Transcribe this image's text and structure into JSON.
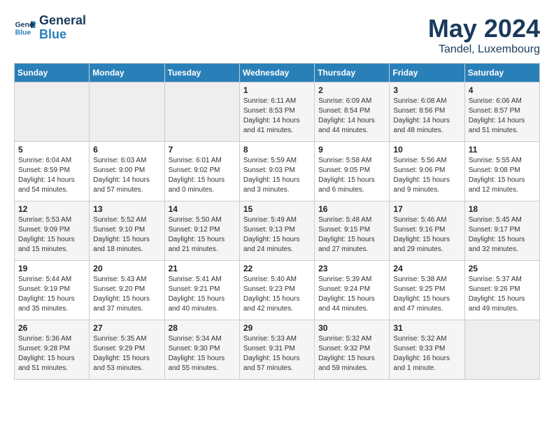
{
  "header": {
    "logo_line1": "General",
    "logo_line2": "Blue",
    "month": "May 2024",
    "location": "Tandel, Luxembourg"
  },
  "days_of_week": [
    "Sunday",
    "Monday",
    "Tuesday",
    "Wednesday",
    "Thursday",
    "Friday",
    "Saturday"
  ],
  "weeks": [
    [
      {
        "day": "",
        "content": ""
      },
      {
        "day": "",
        "content": ""
      },
      {
        "day": "",
        "content": ""
      },
      {
        "day": "1",
        "content": "Sunrise: 6:11 AM\nSunset: 8:53 PM\nDaylight: 14 hours\nand 41 minutes."
      },
      {
        "day": "2",
        "content": "Sunrise: 6:09 AM\nSunset: 8:54 PM\nDaylight: 14 hours\nand 44 minutes."
      },
      {
        "day": "3",
        "content": "Sunrise: 6:08 AM\nSunset: 8:56 PM\nDaylight: 14 hours\nand 48 minutes."
      },
      {
        "day": "4",
        "content": "Sunrise: 6:06 AM\nSunset: 8:57 PM\nDaylight: 14 hours\nand 51 minutes."
      }
    ],
    [
      {
        "day": "5",
        "content": "Sunrise: 6:04 AM\nSunset: 8:59 PM\nDaylight: 14 hours\nand 54 minutes."
      },
      {
        "day": "6",
        "content": "Sunrise: 6:03 AM\nSunset: 9:00 PM\nDaylight: 14 hours\nand 57 minutes."
      },
      {
        "day": "7",
        "content": "Sunrise: 6:01 AM\nSunset: 9:02 PM\nDaylight: 15 hours\nand 0 minutes."
      },
      {
        "day": "8",
        "content": "Sunrise: 5:59 AM\nSunset: 9:03 PM\nDaylight: 15 hours\nand 3 minutes."
      },
      {
        "day": "9",
        "content": "Sunrise: 5:58 AM\nSunset: 9:05 PM\nDaylight: 15 hours\nand 6 minutes."
      },
      {
        "day": "10",
        "content": "Sunrise: 5:56 AM\nSunset: 9:06 PM\nDaylight: 15 hours\nand 9 minutes."
      },
      {
        "day": "11",
        "content": "Sunrise: 5:55 AM\nSunset: 9:08 PM\nDaylight: 15 hours\nand 12 minutes."
      }
    ],
    [
      {
        "day": "12",
        "content": "Sunrise: 5:53 AM\nSunset: 9:09 PM\nDaylight: 15 hours\nand 15 minutes."
      },
      {
        "day": "13",
        "content": "Sunrise: 5:52 AM\nSunset: 9:10 PM\nDaylight: 15 hours\nand 18 minutes."
      },
      {
        "day": "14",
        "content": "Sunrise: 5:50 AM\nSunset: 9:12 PM\nDaylight: 15 hours\nand 21 minutes."
      },
      {
        "day": "15",
        "content": "Sunrise: 5:49 AM\nSunset: 9:13 PM\nDaylight: 15 hours\nand 24 minutes."
      },
      {
        "day": "16",
        "content": "Sunrise: 5:48 AM\nSunset: 9:15 PM\nDaylight: 15 hours\nand 27 minutes."
      },
      {
        "day": "17",
        "content": "Sunrise: 5:46 AM\nSunset: 9:16 PM\nDaylight: 15 hours\nand 29 minutes."
      },
      {
        "day": "18",
        "content": "Sunrise: 5:45 AM\nSunset: 9:17 PM\nDaylight: 15 hours\nand 32 minutes."
      }
    ],
    [
      {
        "day": "19",
        "content": "Sunrise: 5:44 AM\nSunset: 9:19 PM\nDaylight: 15 hours\nand 35 minutes."
      },
      {
        "day": "20",
        "content": "Sunrise: 5:43 AM\nSunset: 9:20 PM\nDaylight: 15 hours\nand 37 minutes."
      },
      {
        "day": "21",
        "content": "Sunrise: 5:41 AM\nSunset: 9:21 PM\nDaylight: 15 hours\nand 40 minutes."
      },
      {
        "day": "22",
        "content": "Sunrise: 5:40 AM\nSunset: 9:23 PM\nDaylight: 15 hours\nand 42 minutes."
      },
      {
        "day": "23",
        "content": "Sunrise: 5:39 AM\nSunset: 9:24 PM\nDaylight: 15 hours\nand 44 minutes."
      },
      {
        "day": "24",
        "content": "Sunrise: 5:38 AM\nSunset: 9:25 PM\nDaylight: 15 hours\nand 47 minutes."
      },
      {
        "day": "25",
        "content": "Sunrise: 5:37 AM\nSunset: 9:26 PM\nDaylight: 15 hours\nand 49 minutes."
      }
    ],
    [
      {
        "day": "26",
        "content": "Sunrise: 5:36 AM\nSunset: 9:28 PM\nDaylight: 15 hours\nand 51 minutes."
      },
      {
        "day": "27",
        "content": "Sunrise: 5:35 AM\nSunset: 9:29 PM\nDaylight: 15 hours\nand 53 minutes."
      },
      {
        "day": "28",
        "content": "Sunrise: 5:34 AM\nSunset: 9:30 PM\nDaylight: 15 hours\nand 55 minutes."
      },
      {
        "day": "29",
        "content": "Sunrise: 5:33 AM\nSunset: 9:31 PM\nDaylight: 15 hours\nand 57 minutes."
      },
      {
        "day": "30",
        "content": "Sunrise: 5:32 AM\nSunset: 9:32 PM\nDaylight: 15 hours\nand 59 minutes."
      },
      {
        "day": "31",
        "content": "Sunrise: 5:32 AM\nSunset: 9:33 PM\nDaylight: 16 hours\nand 1 minute."
      },
      {
        "day": "",
        "content": ""
      }
    ]
  ]
}
